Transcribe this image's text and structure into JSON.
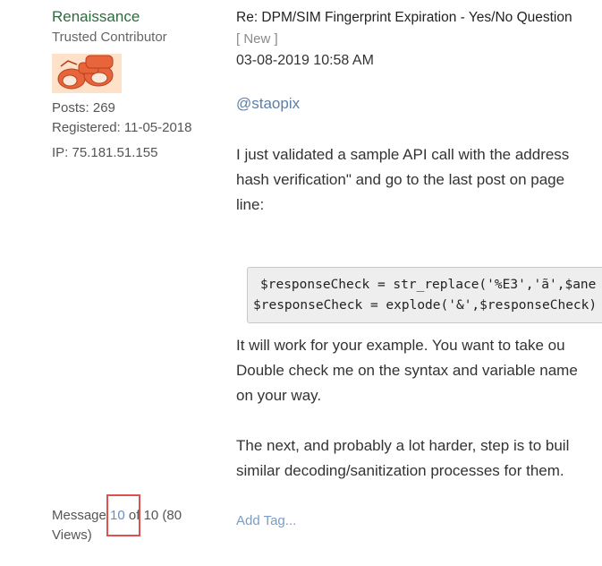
{
  "author": {
    "username": "Renaissance",
    "rank": "Trusted Contributor",
    "avatar_icon": "binoculars-icon",
    "posts": "Posts: 269",
    "registered": "Registered: 11-05-2018",
    "ip": "IP: 75.181.51.155"
  },
  "message_count": {
    "prefix": "Message ",
    "current": "10",
    "middle": " of 10 (80",
    "suffix": "Views)"
  },
  "post": {
    "subject": "Re: DPM/SIM Fingerprint Expiration - Yes/No Question",
    "badge": "[ New ]",
    "date": "03-08-2019 10:58 AM",
    "mention": "@stаopix",
    "para1": [
      "I just validated a sample API call with the address",
      "hash verification\" and go to the last post on page",
      "line:"
    ],
    "code": [
      " $responseCheck = str_replace('%E3','ã',$ane",
      "$responseCheck = explode('&',$responseCheck)"
    ],
    "para2": [
      "It will work for your example.  You want to take ou",
      "Double check me on the syntax and variable name",
      "on your way."
    ],
    "para3": [
      "The next, and probably a lot harder, step is to buil",
      "similar decoding/sanitization processes for them."
    ],
    "add_tag": "Add Tag..."
  },
  "colors": {
    "username": "#2d6b3c",
    "link": "#5b7fa6",
    "highlight": "#d9534f"
  }
}
